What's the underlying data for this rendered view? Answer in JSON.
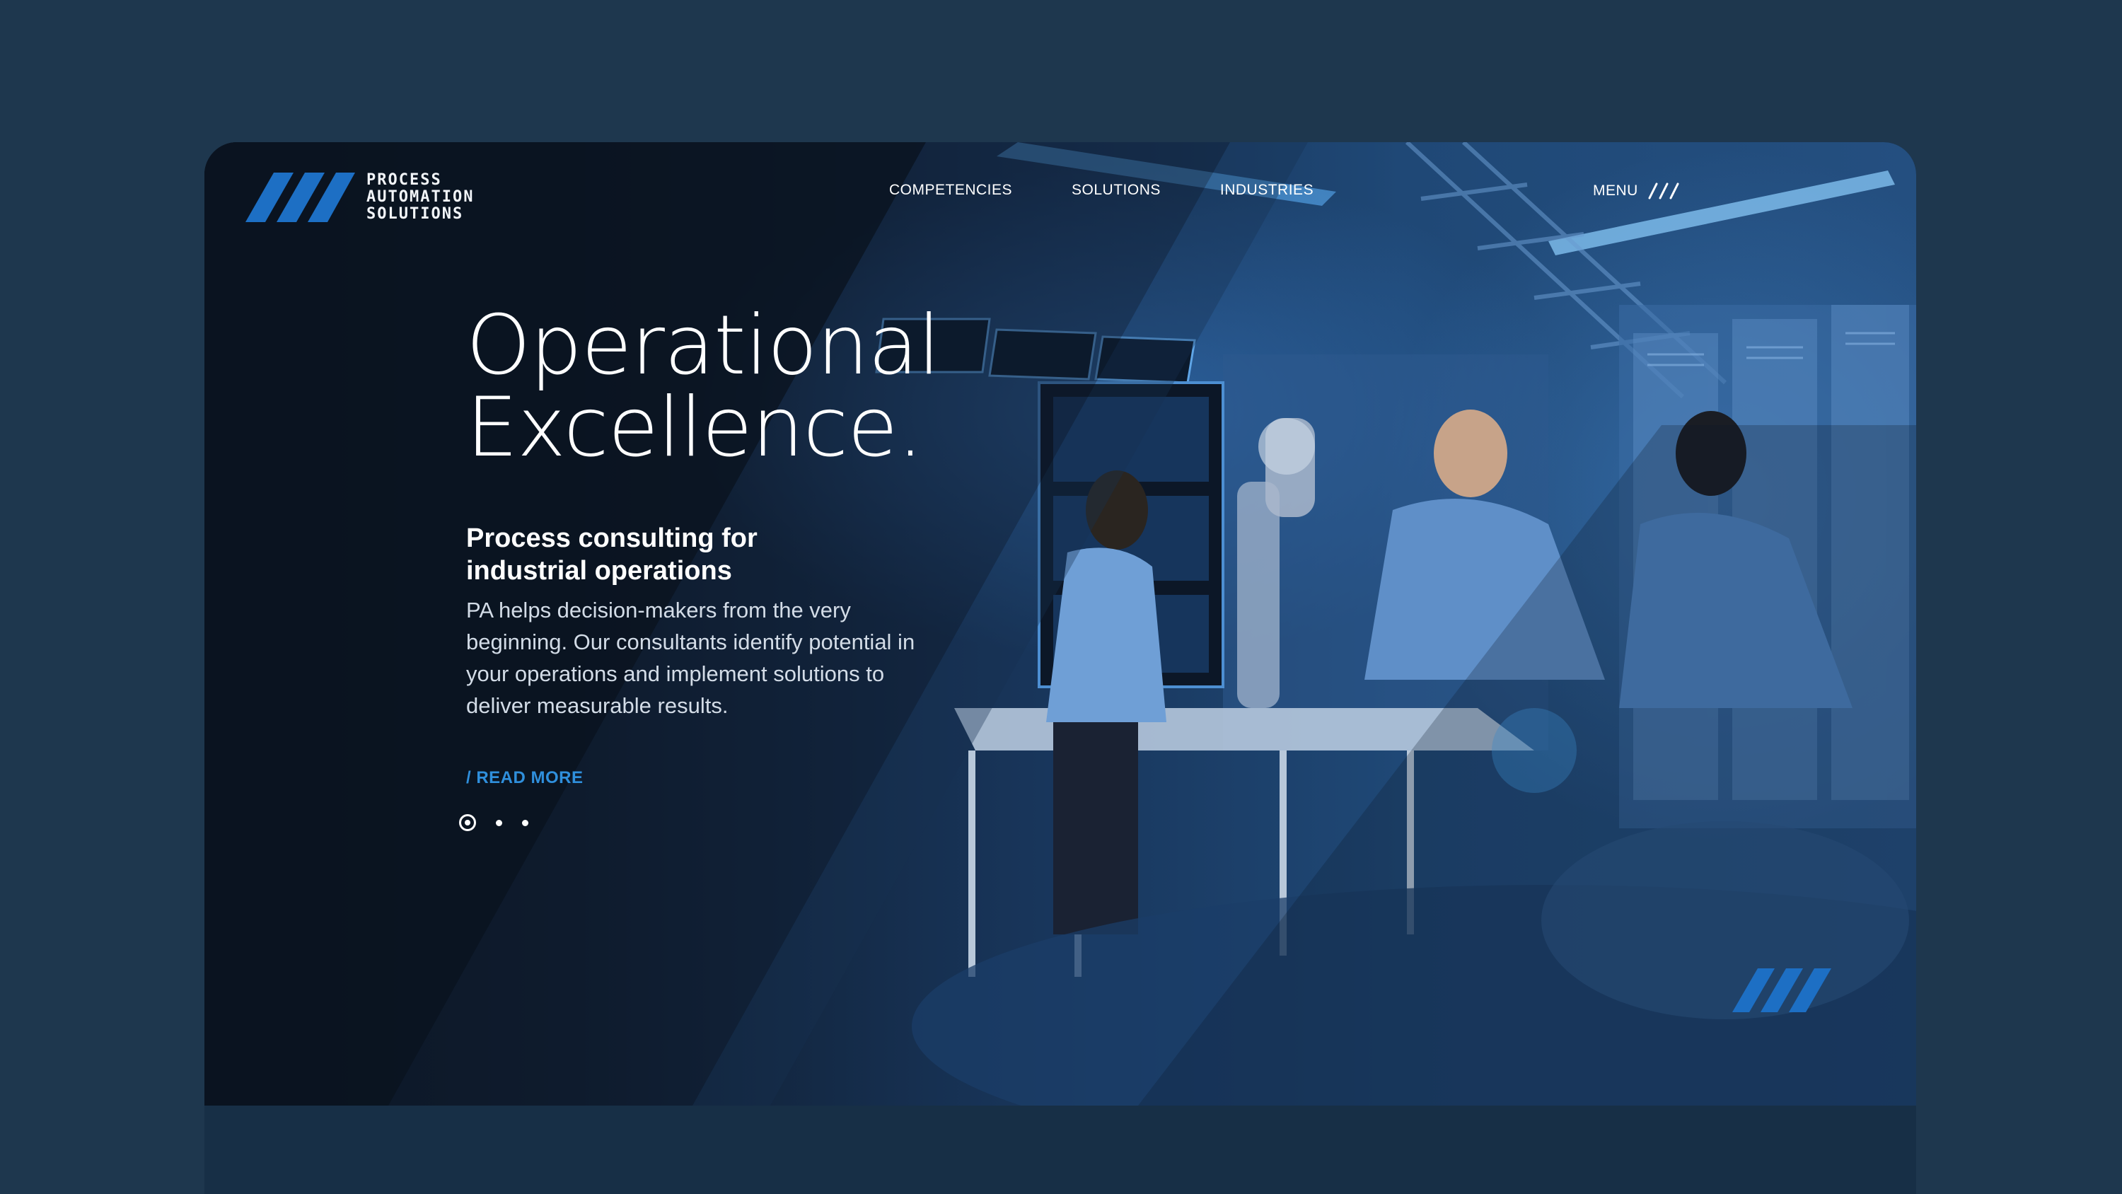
{
  "brand": {
    "logo_line1": "PROCESS",
    "logo_line2": "AUTOMATION",
    "logo_line3": "SOLUTIONS"
  },
  "nav": {
    "items": [
      {
        "label": "COMPETENCIES"
      },
      {
        "label": "SOLUTIONS"
      },
      {
        "label": "INDUSTRIES"
      }
    ],
    "menu_label": "MENU"
  },
  "hero": {
    "headline_line1": "Operational",
    "headline_line2": "Excellence.",
    "subhead": "Process consulting for industrial operations",
    "description": "PA helps decision-makers from the very beginning. Our consultants identify potential in your operations and implement solutions to deliver measurable results.",
    "cta": "/ READ MORE"
  },
  "slider": {
    "total": 3,
    "active_index": 1
  },
  "colors": {
    "page_bg": "#1e374e",
    "accent_blue": "#2f8fdc",
    "logo_blue": "#1d6fc4"
  }
}
